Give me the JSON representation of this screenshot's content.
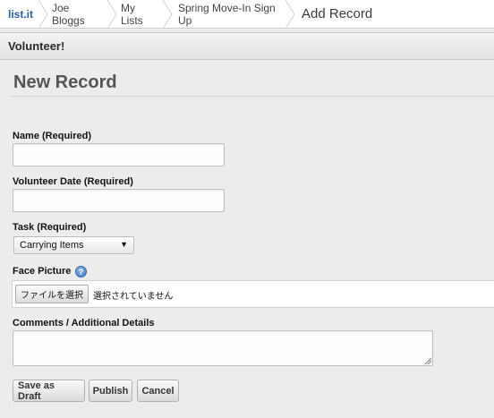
{
  "breadcrumb": {
    "items": [
      "list.it",
      "Joe Bloggs",
      "My Lists",
      "Spring Move-In Sign Up"
    ],
    "current": "Add Record"
  },
  "panel": {
    "title": "Volunteer!"
  },
  "form": {
    "heading": "New Record",
    "name": {
      "label": "Name (Required)",
      "value": ""
    },
    "volunteer_date": {
      "label": "Volunteer Date (Required)",
      "value": ""
    },
    "task": {
      "label": "Task (Required)",
      "selected": "Carrying Items"
    },
    "face_picture": {
      "label": "Face Picture",
      "help_icon": "help-icon",
      "help_glyph": "?",
      "choose_label": "ファイルを選択",
      "status": "選択されていません"
    },
    "comments": {
      "label": "Comments / Additional Details",
      "value": ""
    },
    "buttons": {
      "save_draft": "Save as Draft",
      "publish": "Publish",
      "cancel": "Cancel"
    }
  },
  "colors": {
    "link": "#2a5db0",
    "heading": "#555555",
    "background": "#ececec"
  }
}
